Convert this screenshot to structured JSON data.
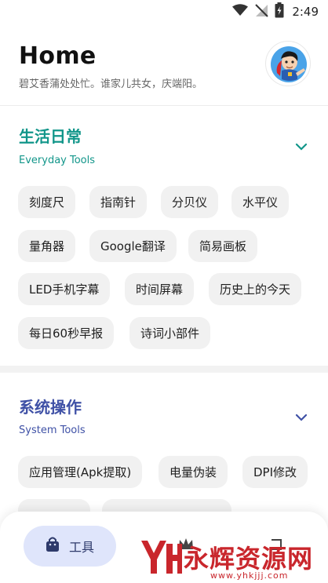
{
  "status_bar": {
    "time": "2:49"
  },
  "header": {
    "title": "Home",
    "subtitle": "碧艾香蒲处处忙。谁家儿共女，庆端阳。"
  },
  "sections": [
    {
      "title": "生活日常",
      "subtitle": "Everyday Tools",
      "accent": "#12968a",
      "chips": [
        "刻度尺",
        "指南针",
        "分贝仪",
        "水平仪",
        "量角器",
        "Google翻译",
        "简易画板",
        "LED手机字幕",
        "时间屏幕",
        "历史上的今天",
        "每日60秒早报",
        "诗词小部件"
      ]
    },
    {
      "title": "系统操作",
      "subtitle": "System Tools",
      "accent": "#3f51a6",
      "chips": [
        "应用管理(Apk提取)",
        "电量伪装",
        "DPI修改"
      ]
    }
  ],
  "bottom_nav": {
    "tools_label": "工具",
    "tools_bg": "#dfe5fb"
  },
  "watermark": {
    "text": "永辉资源网",
    "url": "www.yhkjjj.com",
    "color": "#c9262c"
  }
}
